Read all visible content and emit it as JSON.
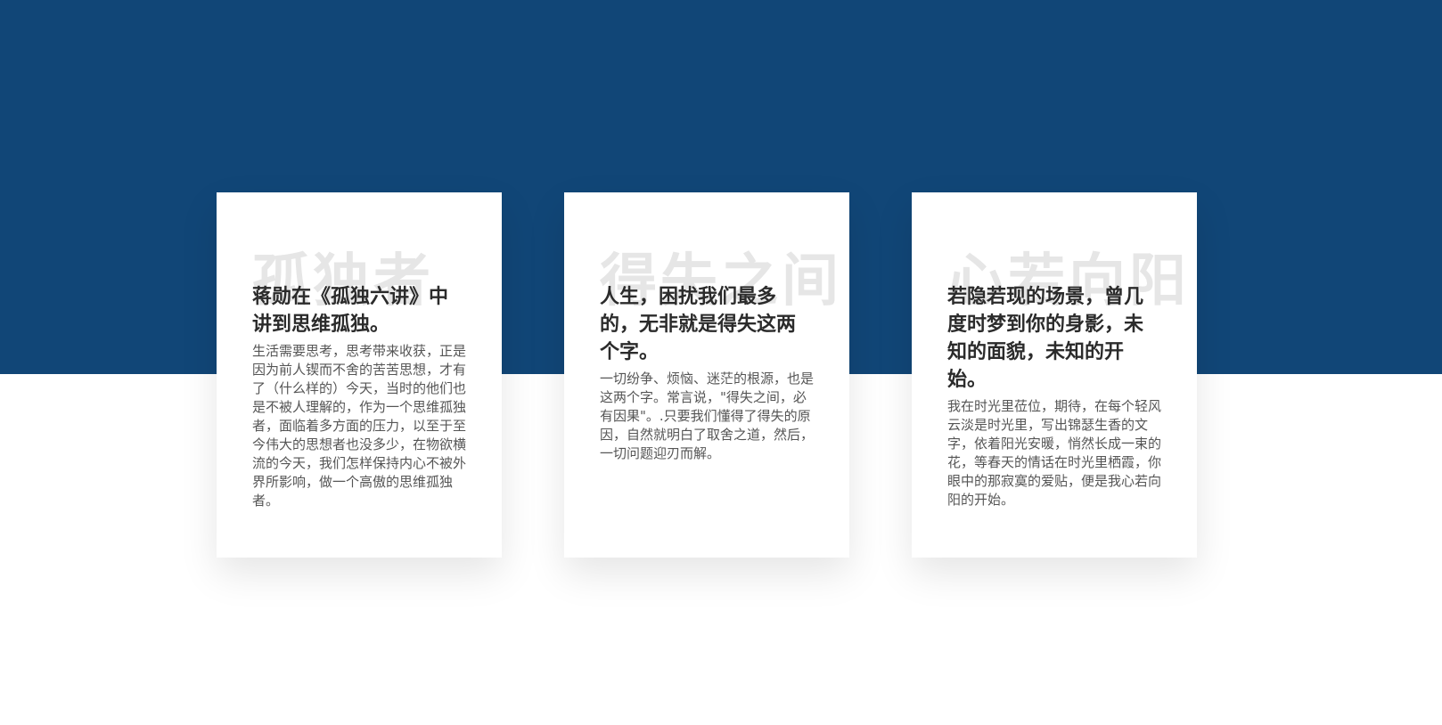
{
  "colors": {
    "hero_band": "#114677",
    "card_background": "#ffffff",
    "title_text": "#2b2b2b",
    "body_text": "#555555",
    "watermark_text": "#e6e6e6"
  },
  "cards": [
    {
      "watermark": "孤独者",
      "title": "蒋勋在《孤独六讲》中讲到思维孤独。",
      "body": "生活需要思考，思考带来收获，正是因为前人锲而不舍的苦苦思想，才有了（什么样的）今天，当时的他们也是不被人理解的，作为一个思维孤独者，面临着多方面的压力，以至于至今伟大的思想者也没多少，在物欲横流的今天，我们怎样保持内心不被外界所影响，做一个高傲的思维孤独者。"
    },
    {
      "watermark": "得失之间",
      "title": "人生，困扰我们最多的，无非就是得失这两个字。",
      "body": "一切纷争、烦恼、迷茫的根源，也是这两个字。常言说，\"得失之间，必有因果\"。.只要我们懂得了得失的原因，自然就明白了取舍之道，然后，一切问题迎刃而解。"
    },
    {
      "watermark": "心若向阳",
      "title": "若隐若现的场景，曾几度时梦到你的身影，未知的面貌，未知的开始。",
      "body": "我在时光里莅位，期待，在每个轻风云淡是时光里，写出锦瑟生香的文字，依着阳光安暖，悄然长成一束的花，等春天的情话在时光里栖霞，你眼中的那寂寞的爱贴，便是我心若向阳的开始。"
    }
  ]
}
